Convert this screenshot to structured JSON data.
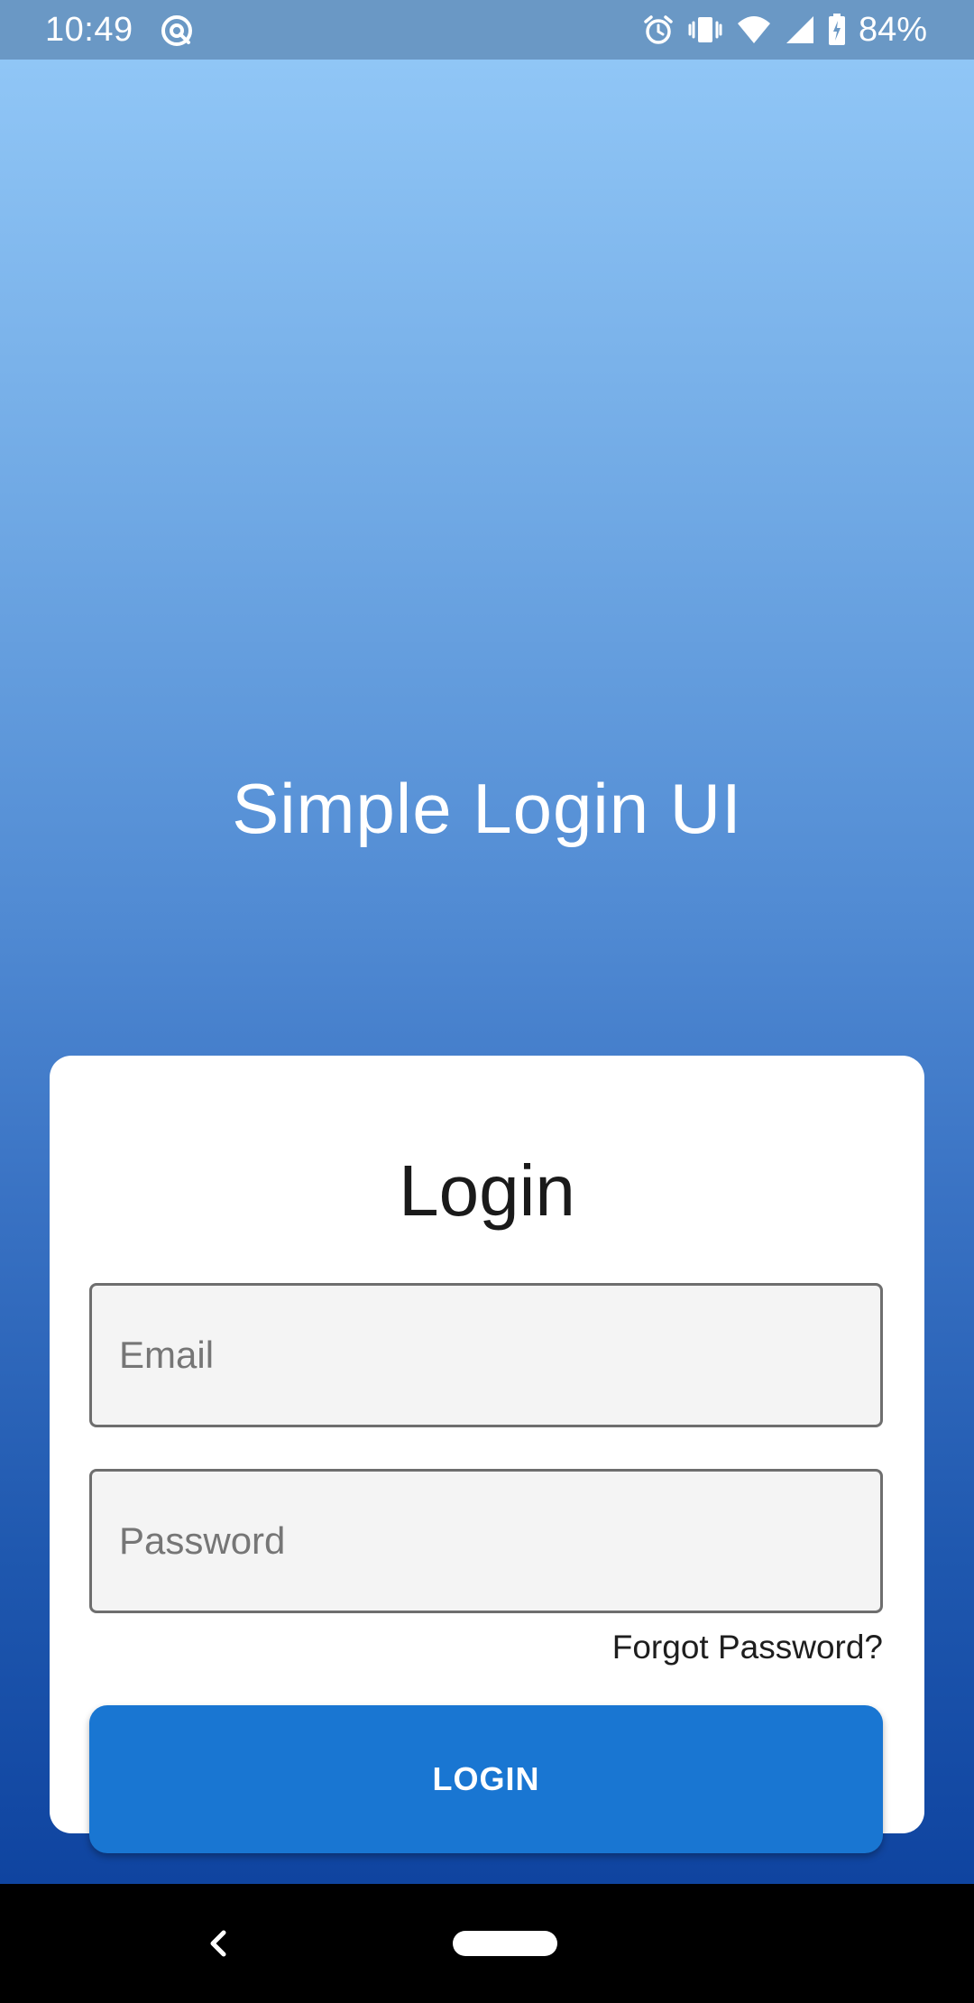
{
  "status_bar": {
    "time": "10:49",
    "battery": "84%",
    "icons": [
      "at-sign-icon",
      "alarm-icon",
      "vibrate-icon",
      "wifi-icon",
      "signal-icon",
      "battery-charging-icon"
    ]
  },
  "app": {
    "title": "Simple Login UI"
  },
  "login_card": {
    "title": "Login",
    "email_placeholder": "Email",
    "password_placeholder": "Password",
    "forgot_password": "Forgot Password?",
    "login_button": "LOGIN"
  },
  "colors": {
    "status_bar": "#6a98c5",
    "gradient_top": "#90c6f6",
    "gradient_bottom": "#0f44a0",
    "button": "#1976d2",
    "field_bg": "#f4f4f4"
  },
  "nav_bar": {
    "icons": [
      "back-icon",
      "home-pill-icon"
    ]
  }
}
